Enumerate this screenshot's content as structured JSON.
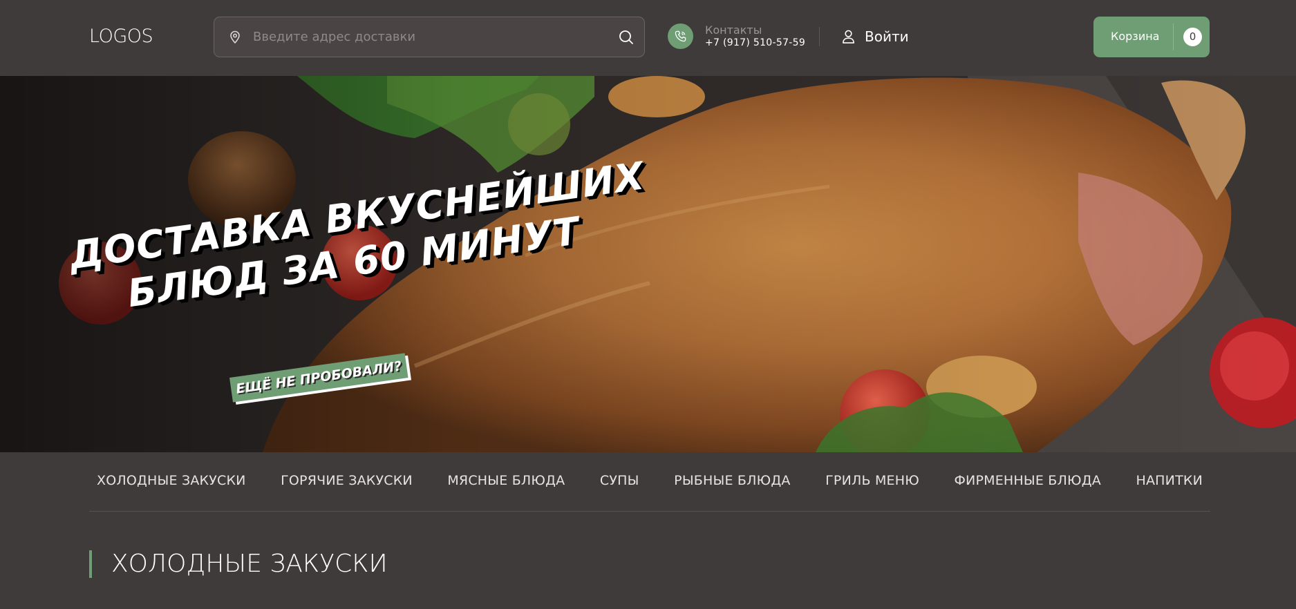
{
  "header": {
    "logo": "LOGOS",
    "search": {
      "placeholder": "Введите адрес доставки"
    },
    "contacts": {
      "label": "Контакты",
      "phone": "+7 (917) 510-57-59"
    },
    "login_label": "Войти",
    "cart": {
      "label": "Корзина",
      "count": "0"
    }
  },
  "hero": {
    "headline_line1": "ДОСТАВКА ВКУСНЕЙШИХ",
    "headline_line2": "БЛЮД ЗА 60 МИНУТ",
    "tag": "ЕЩЁ НЕ ПРОБОВАЛИ?"
  },
  "categories": [
    "ХОЛОДНЫЕ ЗАКУСКИ",
    "ГОРЯЧИЕ ЗАКУСКИ",
    "МЯСНЫЕ БЛЮДА",
    "СУПЫ",
    "РЫБНЫЕ БЛЮДА",
    "ГРИЛЬ МЕНЮ",
    "ФИРМЕННЫЕ БЛЮДА",
    "НАПИТКИ"
  ],
  "section": {
    "title": "ХОЛОДНЫЕ ЗАКУСКИ"
  },
  "colors": {
    "background": "#3f3b3a",
    "accent": "#6f9d74",
    "text": "#ffffff",
    "muted": "#9a9594"
  },
  "icons": {
    "search_pin": "map-pin-icon",
    "search_submit": "search-icon",
    "phone": "phone-icon",
    "login": "user-icon"
  }
}
